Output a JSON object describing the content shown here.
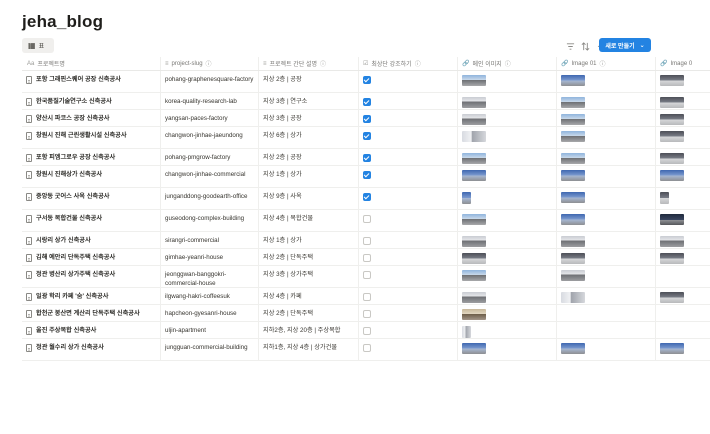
{
  "page": {
    "title": "jeha_blog"
  },
  "toolbar": {
    "new_label": "새로 만들기"
  },
  "headers": [
    {
      "icon": "Aa",
      "label": "프로젝트명",
      "info": ""
    },
    {
      "icon": "≡",
      "label": "project-slug",
      "info": "ⓘ"
    },
    {
      "icon": "≡",
      "label": "프로젝트 간단 설명",
      "info": "ⓘ"
    },
    {
      "icon": "☑",
      "label": "최상단 강조하기",
      "info": "ⓘ"
    },
    {
      "icon": "🔗",
      "label": "메인 이미지",
      "info": "ⓘ"
    },
    {
      "icon": "🔗",
      "label": "Image 01",
      "info": "ⓘ"
    },
    {
      "icon": "🔗",
      "label": "Image 0",
      "info": ""
    }
  ],
  "rows": [
    {
      "name": "포항 그래핀스퀘어 공장 신축공사",
      "slug": "pohang-graphenesquare-factory",
      "desc": "지상 2층 | 공장",
      "featured": true,
      "main": "t-sky",
      "img1": "t-blue",
      "img2": "t-dark"
    },
    {
      "name": "한국품질기술연구소 신축공사",
      "slug": "korea-quality-research-lab",
      "desc": "지상 3층 | 연구소",
      "featured": true,
      "main": "t-grey",
      "img1": "t-sky",
      "img2": "t-dark"
    },
    {
      "name": "양산시 파코스 공장 신축공사",
      "slug": "yangsan-paces-factory",
      "desc": "지상 3층 | 공장",
      "featured": true,
      "main": "t-grey",
      "img1": "t-sky",
      "img2": "t-dark"
    },
    {
      "name": "창원시 진해 근린생활시설 신축공사",
      "slug": "changwon-jinhae-jaeundong",
      "desc": "지상 6층 | 상가",
      "featured": true,
      "main": "t-white",
      "img1": "t-sky",
      "img2": "t-dark"
    },
    {
      "name": "포항 피엠그로우 공장 신축공사",
      "slug": "pohang-pmgrow-factory",
      "desc": "지상 2층 | 공장",
      "featured": true,
      "main": "t-sky",
      "img1": "t-sky",
      "img2": "t-dark"
    },
    {
      "name": "창원시 진해상가 신축공사",
      "slug": "changwon-jinhae-commercial",
      "desc": "지상 1층 | 상가",
      "featured": true,
      "main": "t-blue",
      "img1": "t-blue",
      "img2": "t-blue"
    },
    {
      "name": "중앙동 굿어스 사옥 신축공사",
      "slug": "junganddong-goodearth-office",
      "desc": "지상 9층 | 사옥",
      "featured": true,
      "main": "t-blue sm",
      "img1": "t-blue",
      "img2": "t-dark sm"
    },
    {
      "name": "구서동 복합건물 신축공사",
      "slug": "guseodong-complex-building",
      "desc": "지상 4층 | 복합건물",
      "featured": false,
      "main": "t-sky",
      "img1": "t-blue",
      "img2": "t-night"
    },
    {
      "name": "시랑리 상가 신축공사",
      "slug": "sirangri-commercial",
      "desc": "지상 1층 | 상가",
      "featured": false,
      "main": "t-grey",
      "img1": "t-grey",
      "img2": "t-grey"
    },
    {
      "name": "김해 예안리 단독주택 신축공사",
      "slug": "gimhae-yeanri-house",
      "desc": "지상 2층 | 단독주택",
      "featured": false,
      "main": "t-dark",
      "img1": "t-dark",
      "img2": "t-dark"
    },
    {
      "name": "정관 병산리 상가주택 신축공사",
      "slug": "jeonggwan-banggokri-commercial-house",
      "desc": "지상 3층 | 상가주택",
      "featured": false,
      "main": "t-sky",
      "img1": "t-grey",
      "img2": ""
    },
    {
      "name": "일광 학리 카페 '숨' 신축공사",
      "slug": "ilgwang-hakri-coffeesuk",
      "desc": "지상 4층 | 카페",
      "featured": false,
      "main": "t-grey",
      "img1": "t-white",
      "img2": "t-dark"
    },
    {
      "name": "합천군 봉산면 계산리 단독주택 신축공사",
      "slug": "hapcheon-gyesanri-house",
      "desc": "지상 2층 | 단독주택",
      "featured": false,
      "main": "t-warm",
      "img1": "",
      "img2": ""
    },
    {
      "name": "울진 주상복합 신축공사",
      "slug": "uljin-apartment",
      "desc": "지하2층, 지상 20층 | 주상복합",
      "featured": false,
      "main": "t-white sm",
      "img1": "",
      "img2": ""
    },
    {
      "name": "정관 월수리 상가 신축공사",
      "slug": "jungguan-commercial-building",
      "desc": "지하1층, 지상 4층 | 상가건물",
      "featured": false,
      "main": "t-blue",
      "img1": "t-blue",
      "img2": "t-blue"
    }
  ]
}
